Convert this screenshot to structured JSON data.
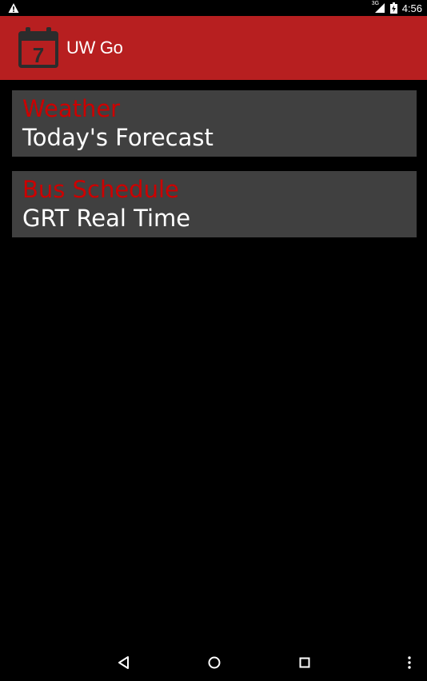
{
  "status_bar": {
    "left_icon": "warning-icon",
    "network_label": "3G",
    "network_icon": "signal-icon",
    "battery_icon": "battery-charging-icon",
    "time": "4:56"
  },
  "app_bar": {
    "title": "UW Go",
    "logo_icon": "calendar-icon",
    "logo_number": "7",
    "color": "#b71f20"
  },
  "cards": [
    {
      "title": "Weather",
      "subtitle": "Today's Forecast"
    },
    {
      "title": "Bus Schedule",
      "subtitle": "GRT Real Time"
    }
  ],
  "nav_bar": {
    "back_icon": "back-triangle-icon",
    "home_icon": "home-circle-icon",
    "recents_icon": "recents-square-icon",
    "menu_icon": "overflow-menu-icon"
  },
  "colors": {
    "accent": "#b71f20",
    "card_title": "#cc0000",
    "card_bg": "#404040",
    "background": "#000000"
  }
}
